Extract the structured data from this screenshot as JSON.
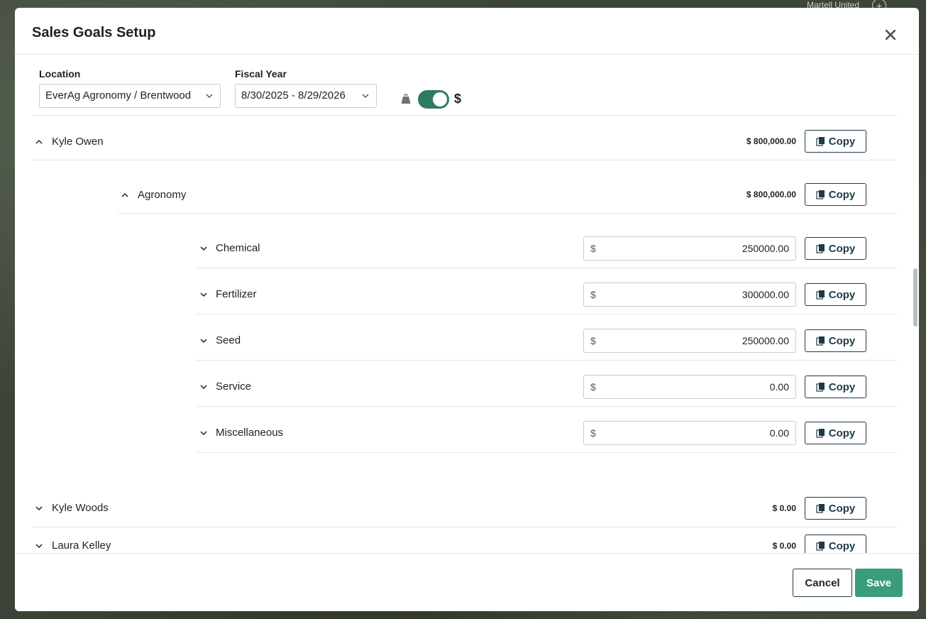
{
  "background": {
    "map_label": "Martell United"
  },
  "modal": {
    "title": "Sales Goals Setup",
    "filters": {
      "location_label": "Location",
      "location_value": "EverAg Agronomy / Brentwood",
      "fiscal_year_label": "Fiscal Year",
      "fiscal_year_value": "8/30/2025 - 8/29/2026",
      "toggle_on": true,
      "toggle_label": "$"
    },
    "copy_label": "Copy",
    "currency_symbol": "$",
    "rows": {
      "kyle_owen": {
        "name": "Kyle Owen",
        "total": "$ 800,000.00"
      },
      "agronomy": {
        "name": "Agronomy",
        "total": "$ 800,000.00"
      },
      "chemical": {
        "name": "Chemical",
        "amount": "250000.00"
      },
      "fertilizer": {
        "name": "Fertilizer",
        "amount": "300000.00"
      },
      "seed": {
        "name": "Seed",
        "amount": "250000.00"
      },
      "service": {
        "name": "Service",
        "amount": "0.00"
      },
      "miscellaneous": {
        "name": "Miscellaneous",
        "amount": "0.00"
      },
      "kyle_woods": {
        "name": "Kyle Woods",
        "total": "$ 0.00"
      },
      "laura_kelley": {
        "name": "Laura Kelley",
        "total": "$ 0.00"
      }
    },
    "footer": {
      "cancel_label": "Cancel",
      "save_label": "Save"
    },
    "colors": {
      "accent": "#3a9c7c",
      "toggle": "#2f7a64",
      "button_border": "#1d3a4a"
    }
  }
}
